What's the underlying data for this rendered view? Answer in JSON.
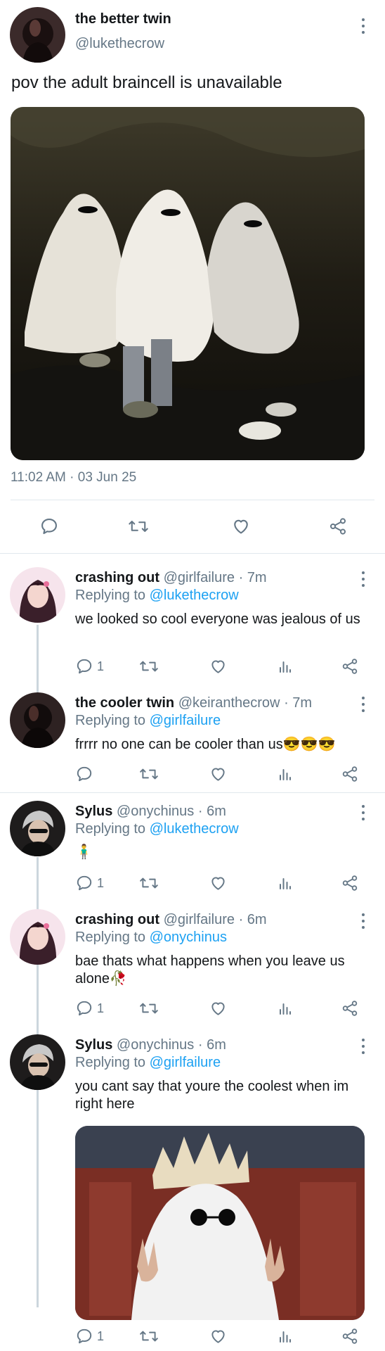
{
  "main_tweet": {
    "author_name": "the better twin",
    "author_handle": "@lukethecrow",
    "text": "pov the adult braincell is unavailable",
    "timestamp": "11:02 AM · 03 Jun 25"
  },
  "replies": [
    {
      "name": "crashing out",
      "handle": "@girlfailure",
      "time": "· 7m",
      "replying_label": "Replying to",
      "replying_to": "@lukethecrow",
      "text": "we looked so cool everyone was jealous of us",
      "reply_count": "1"
    },
    {
      "name": "the cooler twin",
      "handle": "@keiranthecrow",
      "time": "· 7m",
      "replying_label": "Replying to",
      "replying_to": "@girlfailure",
      "text": "frrrr no one can be cooler than us😎😎😎",
      "reply_count": ""
    },
    {
      "name": "Sylus",
      "handle": "@onychinus",
      "time": "· 6m",
      "replying_label": "Replying to",
      "replying_to": "@lukethecrow",
      "text": "🧍‍♂️",
      "reply_count": "1"
    },
    {
      "name": "crashing out",
      "handle": "@girlfailure",
      "time": "· 6m",
      "replying_label": "Replying to",
      "replying_to": "@onychinus",
      "text": "bae thats what happens when you leave us alone🥀",
      "reply_count": "1"
    },
    {
      "name": "Sylus",
      "handle": "@onychinus",
      "time": "· 6m",
      "replying_label": "Replying to",
      "replying_to": "@girlfailure",
      "text": "you cant say that youre the coolest when im right here",
      "reply_count": "1"
    }
  ],
  "icons": {
    "reply": "speech-bubble-icon",
    "retweet": "retweet-icon",
    "like": "heart-icon",
    "views": "bar-chart-icon",
    "share": "share-icon",
    "more": "kebab-menu-icon"
  },
  "colors": {
    "link": "#1da1f2",
    "secondary_text": "#657786",
    "divider": "#e1e8ed",
    "thread_line": "#ccd6dd"
  }
}
